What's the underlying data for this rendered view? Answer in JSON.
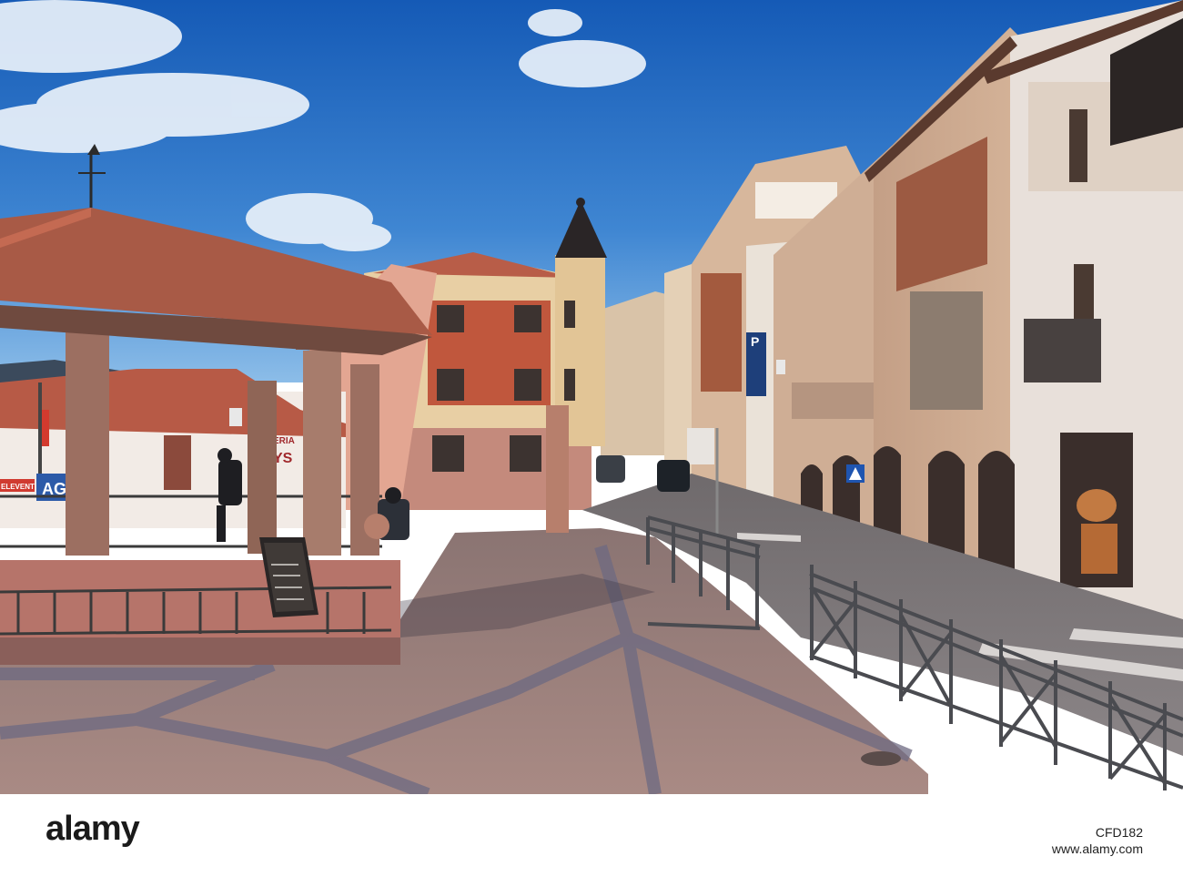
{
  "photo": {
    "sign_parking": "P",
    "storefront_text": "ERIA",
    "storefront_text_2": "YS",
    "blue_banner": "AGO",
    "banner_small": "ELEVENT"
  },
  "footer": {
    "logo": "alamy",
    "image_id": "CFD182",
    "site": "www.alamy.com"
  },
  "colors": {
    "sky_top": "#1a5db8",
    "sky_bottom": "#5f9fd9",
    "roof_tile": "#b35a45",
    "stone": "#c99f7e",
    "pavement": "#9c7f7a"
  }
}
